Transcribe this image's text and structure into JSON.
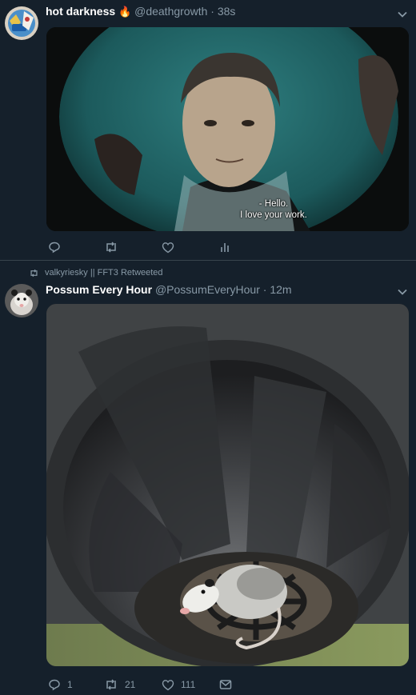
{
  "tweet1": {
    "name": "hot darkness",
    "emoji": "🔥",
    "handle": "@deathgrowth",
    "time": "· 38s",
    "subtitle_lines": [
      "- Hello.",
      "I love your work."
    ]
  },
  "tweet2": {
    "retweet_text": "valkyriesky || FFT3 Retweeted",
    "name": "Possum Every Hour",
    "handle": "@PossumEveryHour",
    "time": "· 12m",
    "reply_count": "1",
    "retweet_count": "21",
    "like_count": "111"
  },
  "colors": {
    "background": "#15202b",
    "secondary_text": "#8899a6",
    "divider": "#38444d"
  },
  "icons": [
    "chevron-down-icon",
    "reply-icon",
    "retweet-icon",
    "like-icon",
    "analytics-icon",
    "message-icon"
  ]
}
